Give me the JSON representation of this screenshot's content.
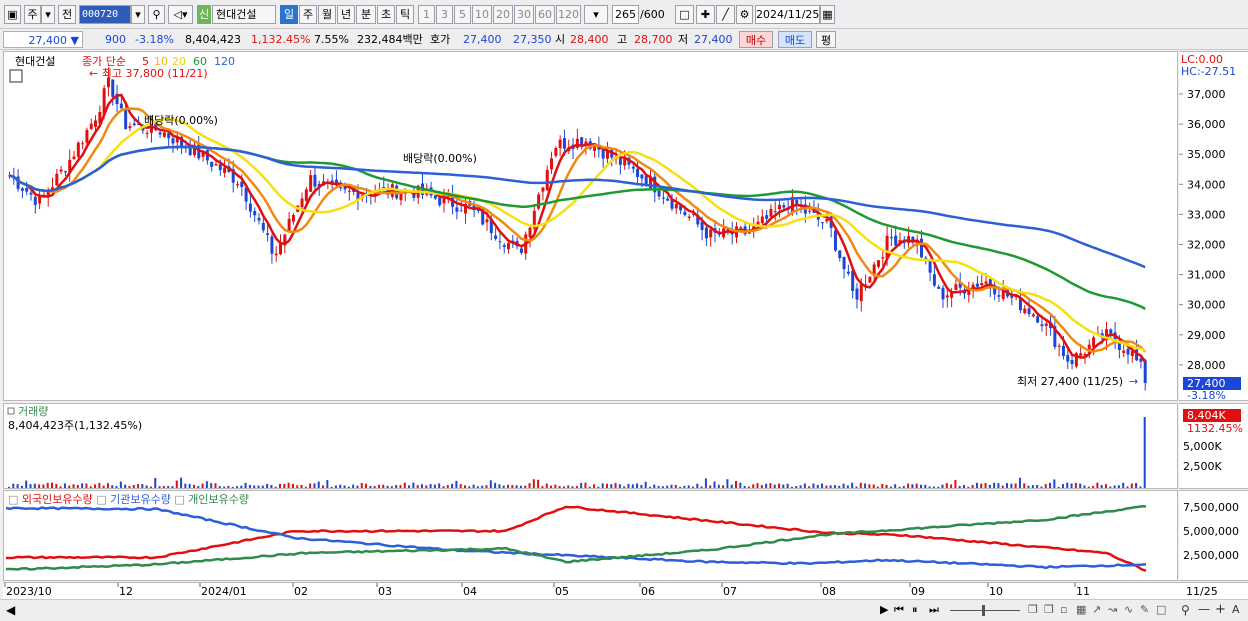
{
  "toolbar": {
    "mode_label": "주",
    "prev_label": "전",
    "code": "000720",
    "stock_name": "현대건설",
    "tag_label": "신",
    "periods": [
      "일",
      "주",
      "월",
      "년",
      "분",
      "초",
      "틱"
    ],
    "active_period": "일",
    "intervals": [
      "1",
      "3",
      "5",
      "10",
      "20",
      "30",
      "60",
      "120"
    ],
    "count": "265",
    "count_total": "/600",
    "date": "2024/11/25"
  },
  "quote": {
    "price": "27,400",
    "change_arrow": "▼",
    "change": "900",
    "change_pct": "-3.18%",
    "volume": "8,404,423",
    "volume_ratio": "1,132.45%",
    "turnover": "7.55%",
    "amount": "232,484백만",
    "bid_label": "호가",
    "ask_price": "27,400",
    "bid_price": "27,350",
    "open_label": "시",
    "open": "28,400",
    "high_label": "고",
    "high": "28,700",
    "low_label": "저",
    "low": "27,400",
    "buy_label": "매수",
    "sell_label": "매도",
    "eval_label": "평"
  },
  "price_pane": {
    "stock_label": "현대건설",
    "ma_label": "종가 단순",
    "ma_periods": [
      "5",
      "10",
      "20",
      "60",
      "120"
    ],
    "high_marker": "최고 37,800 (11/21)",
    "low_marker": "최저 27,400 (11/25)",
    "dividend1": "배당락(0.00%)",
    "dividend2": "배당락(0.00%)",
    "lc": "LC:0.00",
    "hc": "HC:-27.51",
    "last_price": "27,400",
    "last_pct": "-3.18%",
    "axis_ticks": [
      "37,000",
      "36,000",
      "35,000",
      "34,000",
      "33,000",
      "32,000",
      "31,000",
      "30,000",
      "29,000",
      "28,000"
    ]
  },
  "volume_pane": {
    "title": "거래량",
    "value": "8,404,423주(1,132.45%)",
    "last": "8,404K",
    "last_pct": "1132.45%",
    "axis_ticks": [
      "5,000K",
      "2,500K"
    ]
  },
  "holding_pane": {
    "legend": [
      "외국인보유수량",
      "기관보유수량",
      "개인보유수량"
    ],
    "axis_ticks": [
      "7,500,000",
      "5,000,000",
      "2,500,000"
    ]
  },
  "date_axis": {
    "labels": [
      "2023/10",
      "12",
      "2024/01",
      "02",
      "03",
      "04",
      "05",
      "06",
      "07",
      "08",
      "09",
      "10",
      "11"
    ],
    "last_label": "11/25"
  },
  "colors": {
    "up": "#e01010",
    "down": "#1c47d6",
    "ma5": "#e01010",
    "ma10": "#f08a10",
    "ma20": "#f5e012",
    "ma60": "#1e9a32",
    "ma120": "#2f5fd6",
    "foreign": "#e01010",
    "institution": "#2f5fd6",
    "individual": "#2e8b4a"
  }
}
